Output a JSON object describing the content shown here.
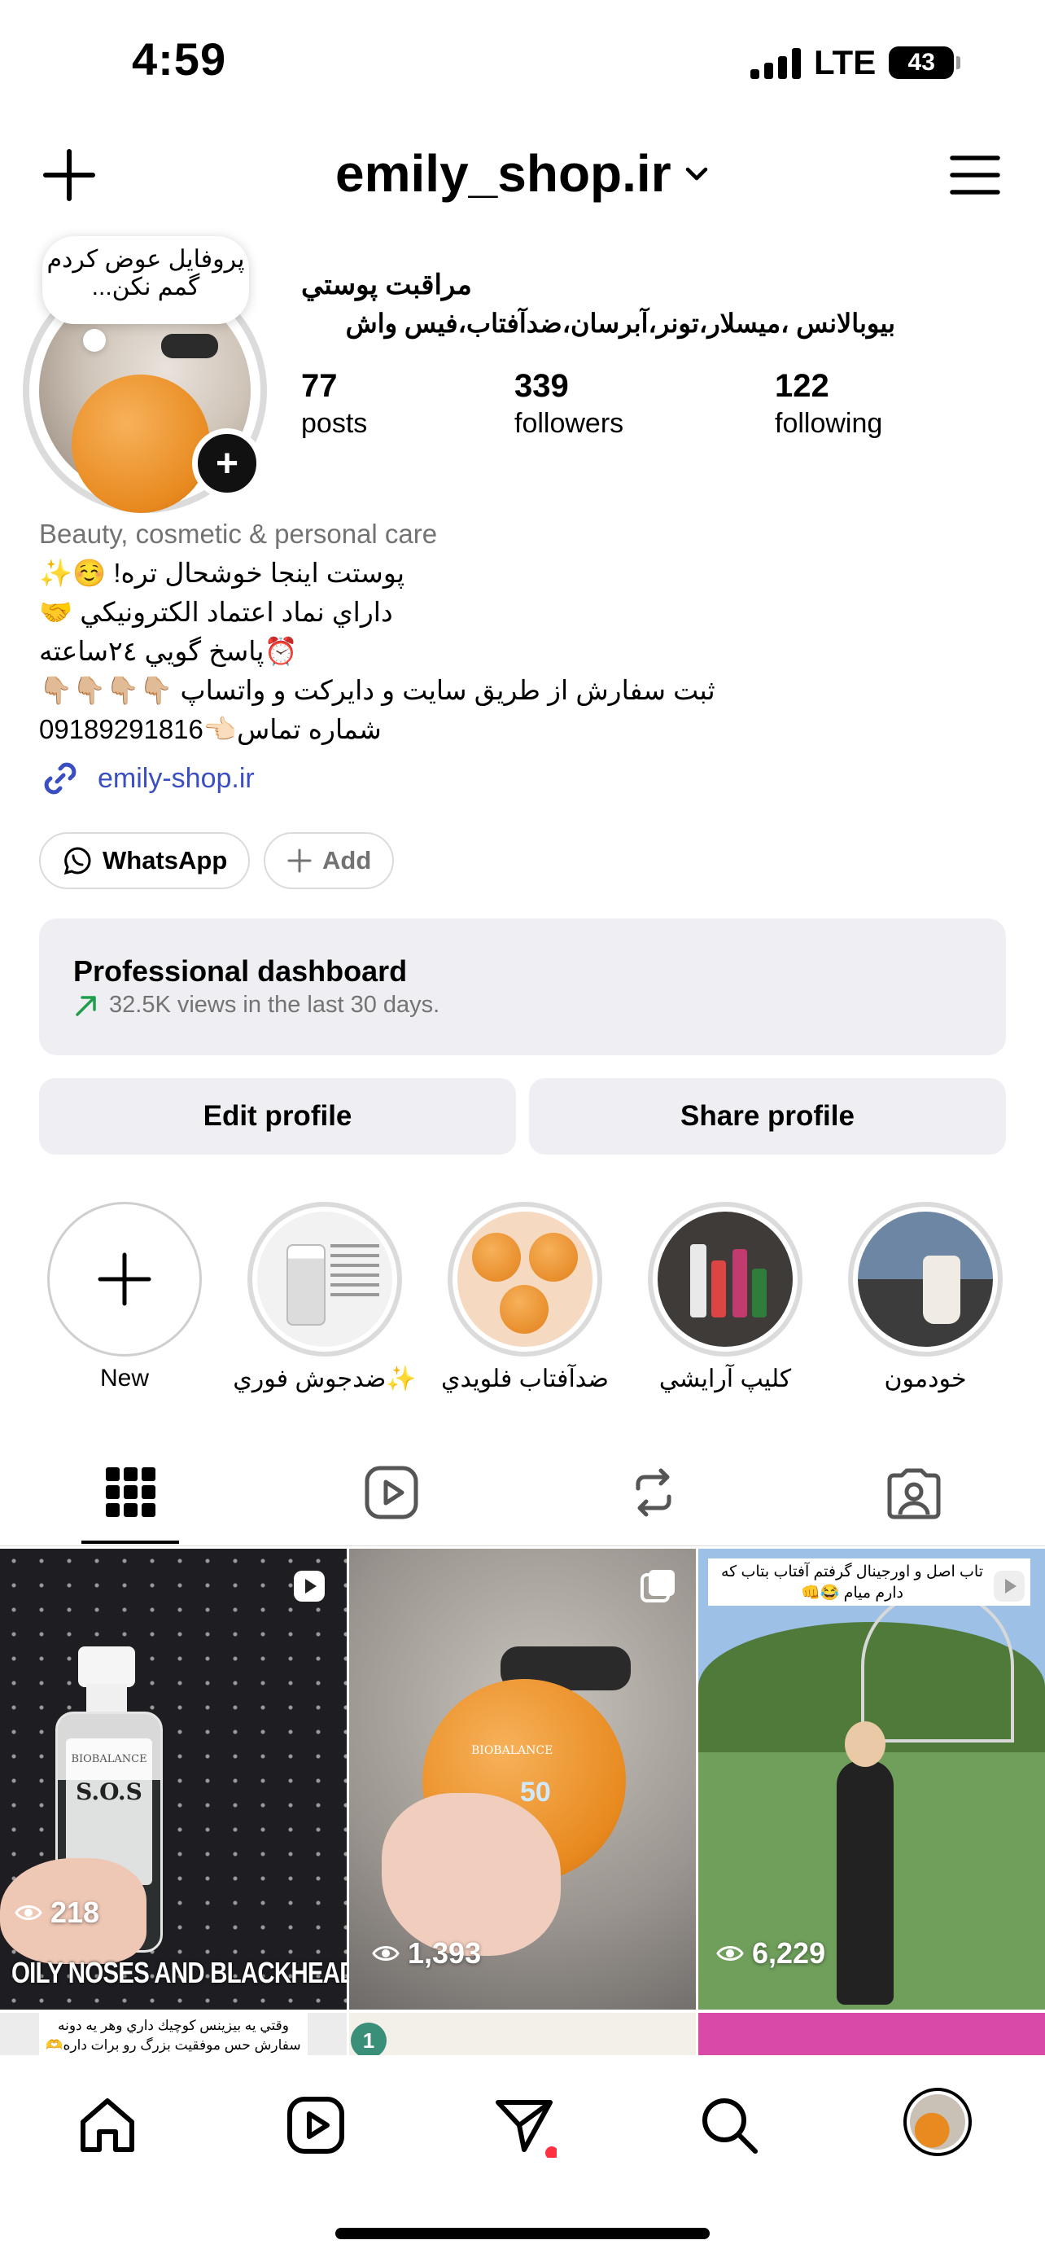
{
  "status_bar": {
    "time": "4:59",
    "network": "LTE",
    "battery": "43"
  },
  "header": {
    "username": "emily_shop.ir"
  },
  "profile": {
    "note": "پروفایل عوض کردم گمم نکن...",
    "display_name": "مراقبت پوستي",
    "category_line": "بيوبالانس ،ميسلار،تونر،آبرسان،ضدآفتاب،فيس واش",
    "stats": [
      {
        "value": "77",
        "label": "posts"
      },
      {
        "value": "339",
        "label": "followers"
      },
      {
        "value": "122",
        "label": "following"
      }
    ],
    "category": "Beauty, cosmetic & personal care",
    "bio_lines": [
      "پوستت اينجا خوشحال تره! ☺️✨",
      "داراي نماد اعتماد الكترونيكي 🤝",
      "⏰پاسخ گويي ٢٤ساعته",
      "ثبت سفارش از طريق سايت و دايركت و واتساپ 👇🏼👇🏼👇🏼👇🏼",
      "شماره تماس👈🏻09189291816"
    ],
    "link": "emily-shop.ir",
    "chips": {
      "whatsapp": "WhatsApp",
      "add": "Add"
    }
  },
  "dashboard": {
    "title": "Professional dashboard",
    "subtitle": "32.5K views in the last 30 days."
  },
  "buttons": {
    "edit": "Edit profile",
    "share": "Share profile"
  },
  "highlights": [
    {
      "label": "New"
    },
    {
      "label": "✨ضدجوش فوري"
    },
    {
      "label": "ضدآفتاب فلويدي"
    },
    {
      "label": "كليپ آرايشي"
    },
    {
      "label": "خودمون"
    }
  ],
  "grid": [
    {
      "views": "218",
      "caption": "OILY NOSES AND BLACKHEADS",
      "product": "S.O.S",
      "brand": "BIOBALANCE"
    },
    {
      "views": "1,393",
      "brand": "BIOBALANCE",
      "spf": "50"
    },
    {
      "views": "6,229",
      "caption": "تاب اصل و اورجينال گرفتم آفتاب بتاب كه دارم ميام 😂👊"
    }
  ],
  "row2": {
    "caption": "وقتي يه بيزينس كوچيك داري وهر يه دونه سفارش حس موفقيت بزرگ رو برات داره🫶😭",
    "badge": "1"
  },
  "colors": {
    "link": "#3b4fc2",
    "notification": "#ff3040",
    "secondary_bg": "#efeff3"
  }
}
